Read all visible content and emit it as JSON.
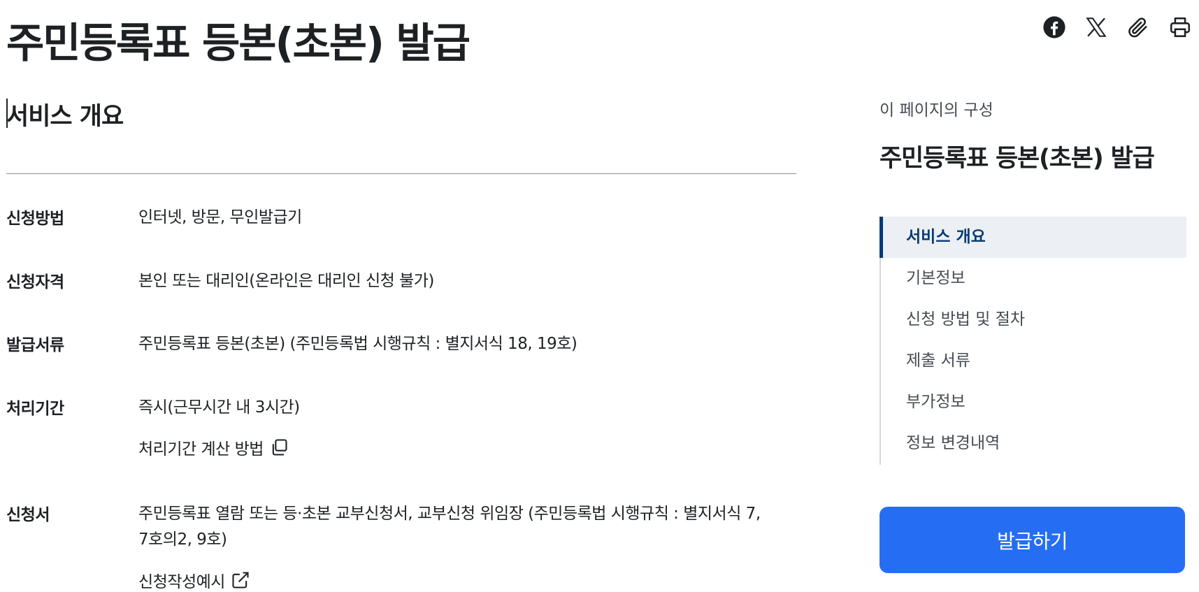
{
  "page": {
    "title": "주민등록표 등본(초본) 발급"
  },
  "share": {
    "icons": [
      "facebook-icon",
      "x-icon",
      "paperclip-icon",
      "printer-icon"
    ]
  },
  "overview": {
    "section_title": "서비스 개요",
    "rows": [
      {
        "label": "신청방법",
        "lines": [
          "인터넷, 방문, 무인발급기"
        ]
      },
      {
        "label": "신청자격",
        "lines": [
          "본인 또는 대리인(온라인은 대리인 신청 불가)"
        ]
      },
      {
        "label": "발급서류",
        "lines": [
          "주민등록표 등본(초본) (주민등록법 시행규칙 : 별지서식 18, 19호)"
        ]
      },
      {
        "label": "처리기간",
        "lines": [
          "즉시(근무시간 내 3시간)"
        ],
        "link": "처리기간 계산 방법"
      },
      {
        "label": "신청서",
        "lines": [
          "주민등록표 열람 또는 등·초본 교부신청서, 교부신청 위임장 (주민등록법 시행규칙 : 별지서식 7,",
          "7호의2, 9호)"
        ],
        "link": "신청작성예시"
      }
    ]
  },
  "toc": {
    "caption": "이 페이지의 구성",
    "title": "주민등록표 등본(초본) 발급",
    "items": [
      "서비스 개요",
      "기본정보",
      "신청 방법 및 절차",
      "제출 서류",
      "부가정보",
      "정보 변경내역"
    ],
    "active_index": 0
  },
  "cta": {
    "label": "발급하기",
    "color": "#256ef4"
  }
}
